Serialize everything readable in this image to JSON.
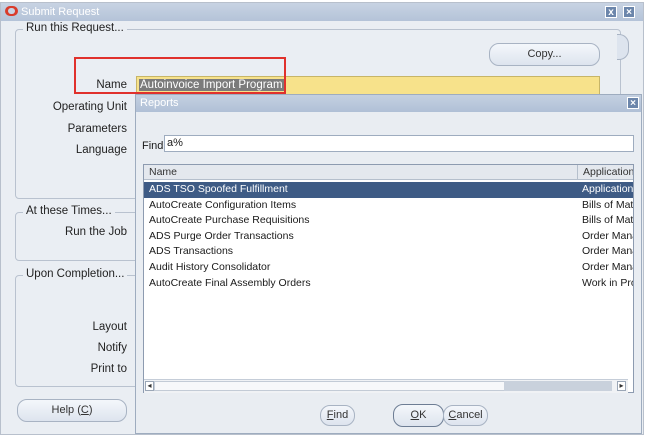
{
  "window": {
    "title": "Submit Request",
    "close_icon": "close-icon",
    "help_icon": "help-icon"
  },
  "run_request": {
    "group_title": "Run this Request...",
    "copy_button": "Copy...",
    "name_label": "Name",
    "name_value": "Autoinvoice Import Program",
    "operating_unit_label": "Operating Unit",
    "parameters_label": "Parameters",
    "language_label": "Language"
  },
  "times": {
    "group_title": "At these Times...",
    "run_the_job_label": "Run the Job"
  },
  "completion": {
    "group_title": "Upon Completion...",
    "layout_label": "Layout",
    "notify_label": "Notify",
    "print_to_label": "Print to"
  },
  "help_button": {
    "text": "Help (",
    "mnemonic": "C",
    "suffix": ")"
  },
  "reports_dialog": {
    "title": "Reports",
    "find_label": "Find",
    "find_value": "a%",
    "columns": {
      "name": "Name",
      "application": "Application"
    },
    "rows": [
      {
        "name": "ADS TSO Spoofed Fulfillment",
        "application": "Application",
        "selected": true
      },
      {
        "name": "AutoCreate Configuration Items",
        "application": "Bills of Mat"
      },
      {
        "name": "AutoCreate Purchase Requisitions",
        "application": "Bills of Mat"
      },
      {
        "name": "ADS Purge Order Transactions",
        "application": "Order Mana"
      },
      {
        "name": "ADS Transactions",
        "application": "Order Mana"
      },
      {
        "name": "Audit History Consolidator",
        "application": "Order Mana"
      },
      {
        "name": "AutoCreate Final Assembly Orders",
        "application": "Work in Pro"
      }
    ],
    "buttons": {
      "find": {
        "mnemonic": "F",
        "rest": "ind"
      },
      "ok": {
        "mnemonic": "O",
        "rest": "K"
      },
      "cancel": {
        "mnemonic": "C",
        "rest": "ancel"
      }
    }
  },
  "colors": {
    "title_bar": "#b4c3d8",
    "selected_row": "#3e5b85",
    "name_field": "#f7e28b",
    "highlight_box": "#e0312c"
  }
}
